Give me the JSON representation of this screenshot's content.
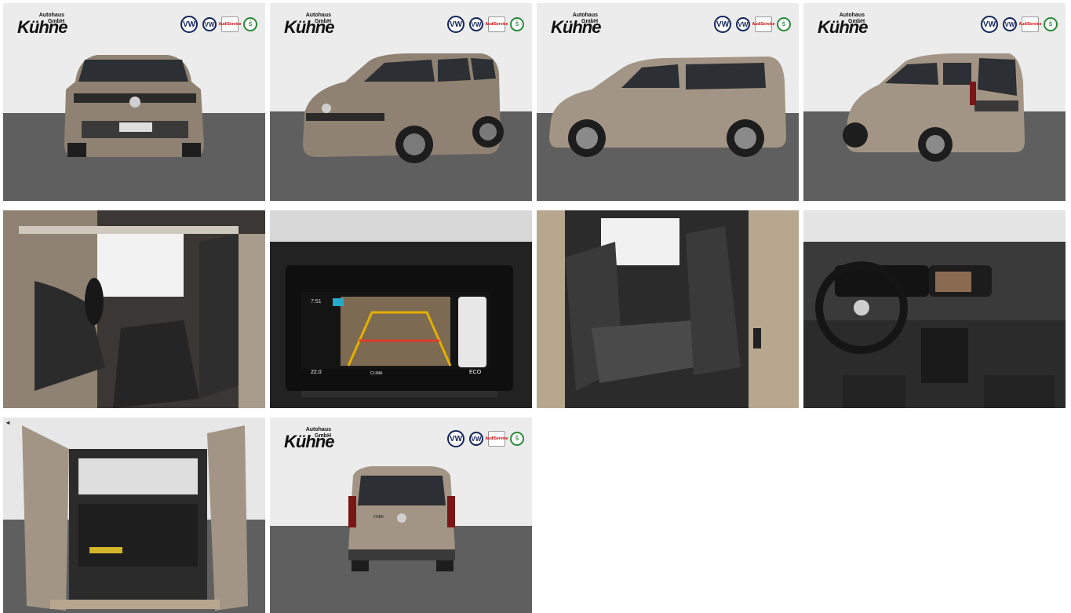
{
  "dealer": {
    "name": "Kühne",
    "sub_line1": "Autohaus",
    "sub_line2": "GmbH"
  },
  "brand_badges": {
    "vw": "VW",
    "vwn": "VW",
    "audi_line1": "Audi",
    "audi_line2": "Service",
    "skoda": "Š"
  },
  "screen": {
    "time": "7:51",
    "temp_left": "22.0",
    "clima": "CLIMA",
    "eco": "ECO"
  },
  "rear": {
    "badge": "FNBK"
  },
  "front": {
    "plate": "Kühne"
  },
  "colors": {
    "car_body": "#9a8c7c",
    "floor": "#5f5f5f",
    "wall": "#ececec",
    "vw_blue": "#13245a"
  }
}
